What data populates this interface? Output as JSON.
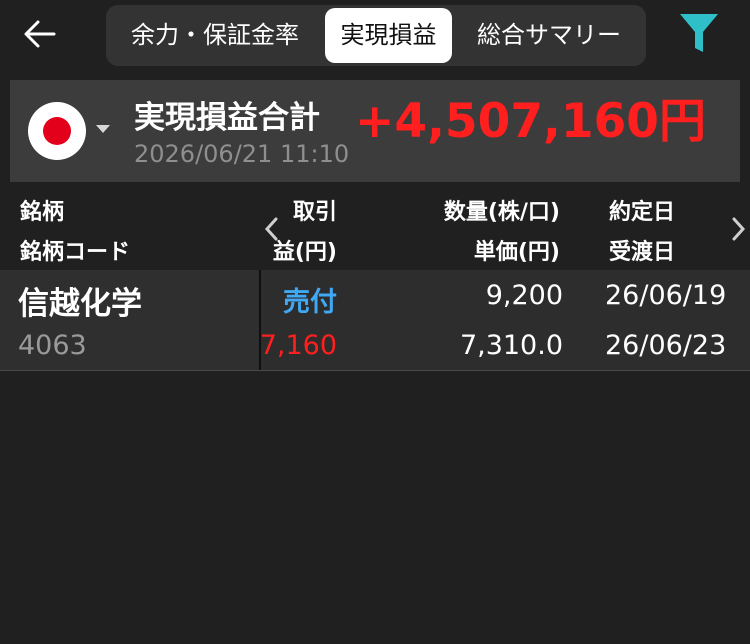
{
  "header": {
    "back_icon": "arrow-left-icon",
    "tabs": [
      {
        "label": "余力・保証金率",
        "active": false
      },
      {
        "label": "実現損益",
        "active": true
      },
      {
        "label": "総合サマリー",
        "active": false
      }
    ],
    "filter_icon": "filter-icon",
    "filter_color": "#2fbfc9"
  },
  "summary": {
    "flag_icon": "japan-flag-icon",
    "title": "実現損益合計",
    "datetime": "2026/06/21 11:10",
    "total": "+4,507,160円",
    "total_color": "#ff1f1f"
  },
  "table": {
    "headers": {
      "row1": {
        "name": "銘柄",
        "trade": "取引",
        "quantity": "数量(株/口)",
        "contract_date": "約定日"
      },
      "row2": {
        "code": "銘柄コード",
        "pnl": "益(円)",
        "unit_price": "単価(円)",
        "settle_date": "受渡日"
      }
    },
    "rows": [
      {
        "name": "信越化学",
        "code": "4063",
        "trade": "売付",
        "pnl": "7,160",
        "quantity": "9,200",
        "unit_price": "7,310.0",
        "contract_date": "26/06/19",
        "settle_date": "26/06/23"
      }
    ],
    "trade_color": "#3fa9f5",
    "pnl_color": "#ff1f1f"
  }
}
